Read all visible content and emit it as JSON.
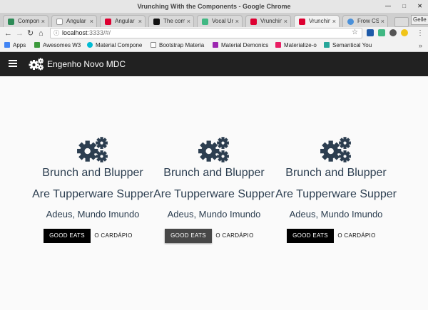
{
  "window": {
    "title": "Vrunching With the Components - Google Chrome"
  },
  "tabs": [
    {
      "label": "Compone",
      "color": "#2e8b57"
    },
    {
      "label": "Angular F",
      "color": "#888888"
    },
    {
      "label": "Angular I",
      "color": "#dd0031"
    },
    {
      "label": "The comp",
      "color": "#111111"
    },
    {
      "label": "Vocal Un",
      "color": "#41b883"
    },
    {
      "label": "Vrunchin",
      "color": "#dd0031"
    },
    {
      "label": "Vrunchin",
      "color": "#dd0031",
      "active": true
    },
    {
      "label": "Frow CSS",
      "color": "#4a90d9"
    }
  ],
  "profile": "Gelle",
  "toolbar": {
    "url_host": "localhost",
    "url_rest": ":3333/#/"
  },
  "bookmarks": [
    {
      "label": "Apps",
      "color": "#4285f4"
    },
    {
      "label": "Awesomes W3",
      "color": "#3c9a3c"
    },
    {
      "label": "Material Compone",
      "color": "#00bcd4"
    },
    {
      "label": "Bootstrap Materia",
      "color": "#888888"
    },
    {
      "label": "Material Demonics",
      "color": "#9c27b0"
    },
    {
      "label": "Materialize-o",
      "color": "#e91e63"
    },
    {
      "label": "Semantical You",
      "color": "#26a69a"
    }
  ],
  "appbar": {
    "title": "Engenho Novo MDC"
  },
  "cards": [
    {
      "title1": "Brunch and Blupper",
      "title2": "Are Tupperware Supper",
      "subtitle": "Adeus, Mundo Imundo",
      "primary": "GOOD EATS",
      "secondary": "O CARDÁPIO"
    },
    {
      "title1": "Brunch and Blupper",
      "title2": "Are Tupperware Supper",
      "subtitle": "Adeus, Mundo Imundo",
      "primary": "GOOD EATS",
      "secondary": "O CARDÁPIO"
    },
    {
      "title1": "Brunch and Blupper",
      "title2": "Are Tupperware Supper",
      "subtitle": "Adeus, Mundo Imundo",
      "primary": "GOOD EATS",
      "secondary": "O CARDÁPIO"
    }
  ],
  "colors": {
    "appbar": "#212121",
    "heading": "#2c3e50",
    "button": "#000000",
    "button_hover": "#474747"
  }
}
